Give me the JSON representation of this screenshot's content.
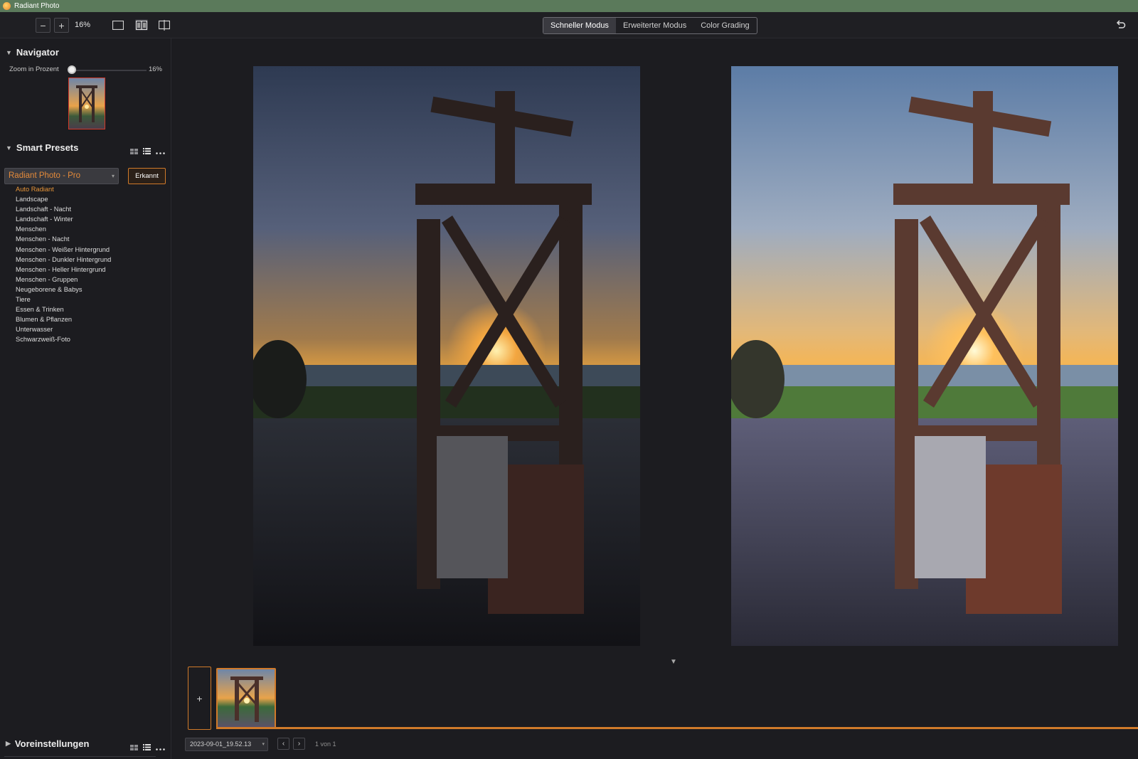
{
  "window": {
    "title": "Radiant Photo"
  },
  "toolbar": {
    "zoom_out_symbol": "−",
    "zoom_in_symbol": "+",
    "zoom_value": "16%",
    "view_icons": [
      "single-view-icon",
      "side-by-side-view-icon",
      "split-view-icon"
    ],
    "modes": [
      "Schneller Modus",
      "Erweiterter Modus",
      "Color Grading"
    ],
    "active_mode": "Schneller Modus",
    "undo_icon": "undo-icon"
  },
  "navigator": {
    "title": "Navigator",
    "zoom_label": "Zoom in Prozent",
    "zoom_value": "16%",
    "zoom_fraction": 0.16
  },
  "smart_presets": {
    "title": "Smart Presets",
    "selected_preset": "Radiant Photo - Pro",
    "recognized_button": "Erkannt",
    "items": [
      "Auto Radiant",
      "Landscape",
      "Landschaft - Nacht",
      "Landschaft - Winter",
      "Menschen",
      "Menschen - Nacht",
      "Menschen - Weißer Hintergrund",
      "Menschen - Dunkler Hintergrund",
      "Menschen - Heller Hintergrund",
      "Menschen - Gruppen",
      "Neugeborene & Babys",
      "Tiere",
      "Essen & Trinken",
      "Blumen & Pflanzen",
      "Unterwasser",
      "Schwarzweiß-Foto"
    ],
    "active_item": "Auto Radiant"
  },
  "voreinstellungen": {
    "title": "Voreinstellungen"
  },
  "filmstrip": {
    "add_symbol": "+",
    "file_name": "2023-09-01_19.52.13",
    "page_info": "1 von 1",
    "prev_symbol": "‹",
    "next_symbol": "›"
  },
  "colors": {
    "accent": "#d07a2a",
    "preset_text": "#e38a3a",
    "titlebar": "#5b7a5b",
    "background": "#1c1c20"
  }
}
